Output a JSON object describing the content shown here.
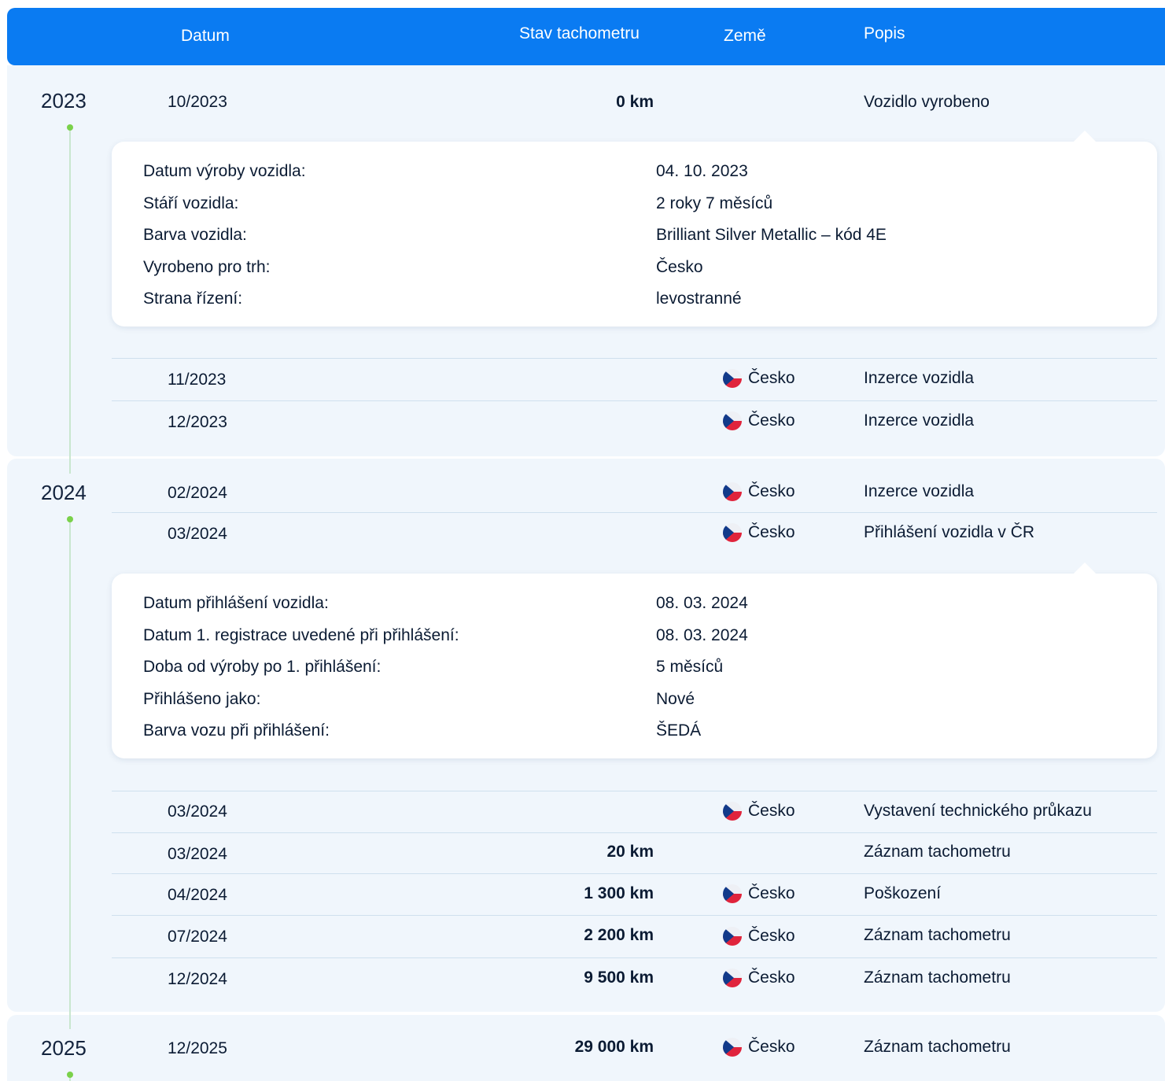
{
  "header": {
    "col_date": "Datum",
    "col_km": "Stav tachometru",
    "col_country": "Země",
    "col_desc": "Popis"
  },
  "years": [
    "2023",
    "2024",
    "2025"
  ],
  "rows": [
    {
      "date": "10/2023",
      "km": "0 km",
      "country": "",
      "desc": "Vozidlo vyrobeno"
    },
    {
      "date": "11/2023",
      "km": "",
      "country": "Česko",
      "desc": "Inzerce vozidla"
    },
    {
      "date": "12/2023",
      "km": "",
      "country": "Česko",
      "desc": "Inzerce vozidla"
    },
    {
      "date": "02/2024",
      "km": "",
      "country": "Česko",
      "desc": "Inzerce vozidla"
    },
    {
      "date": "03/2024",
      "km": "",
      "country": "Česko",
      "desc": "Přihlášení vozidla v ČR"
    },
    {
      "date": "03/2024",
      "km": "",
      "country": "Česko",
      "desc": "Vystavení technického průkazu"
    },
    {
      "date": "03/2024",
      "km": "20 km",
      "country": "",
      "desc": "Záznam tachometru"
    },
    {
      "date": "04/2024",
      "km": "1 300 km",
      "country": "Česko",
      "desc": "Poškození"
    },
    {
      "date": "07/2024",
      "km": "2 200 km",
      "country": "Česko",
      "desc": "Záznam tachometru"
    },
    {
      "date": "12/2024",
      "km": "9 500 km",
      "country": "Česko",
      "desc": "Záznam tachometru"
    },
    {
      "date": "12/2025",
      "km": "29 000 km",
      "country": "Česko",
      "desc": "Záznam tachometru"
    }
  ],
  "production_details": [
    {
      "label": "Datum výroby vozidla:",
      "value": "04. 10. 2023"
    },
    {
      "label": "Stáří vozidla:",
      "value": "2 roky 7 měsíců"
    },
    {
      "label": "Barva vozidla:",
      "value": "Brilliant Silver Metallic – kód 4E"
    },
    {
      "label": "Vyrobeno pro trh:",
      "value": "Česko"
    },
    {
      "label": "Strana řízení:",
      "value": "levostranné"
    }
  ],
  "registration_details": [
    {
      "label": "Datum přihlášení vozidla:",
      "value": "08. 03. 2024"
    },
    {
      "label": "Datum 1. registrace uvedené při přihlášení:",
      "value": "08. 03. 2024"
    },
    {
      "label": "Doba od výroby po 1. přihlášení:",
      "value": "5 měsíců"
    },
    {
      "label": "Přihlášeno jako:",
      "value": "Nové"
    },
    {
      "label": "Barva vozu při přihlášení:",
      "value": "ŠEDÁ"
    }
  ]
}
